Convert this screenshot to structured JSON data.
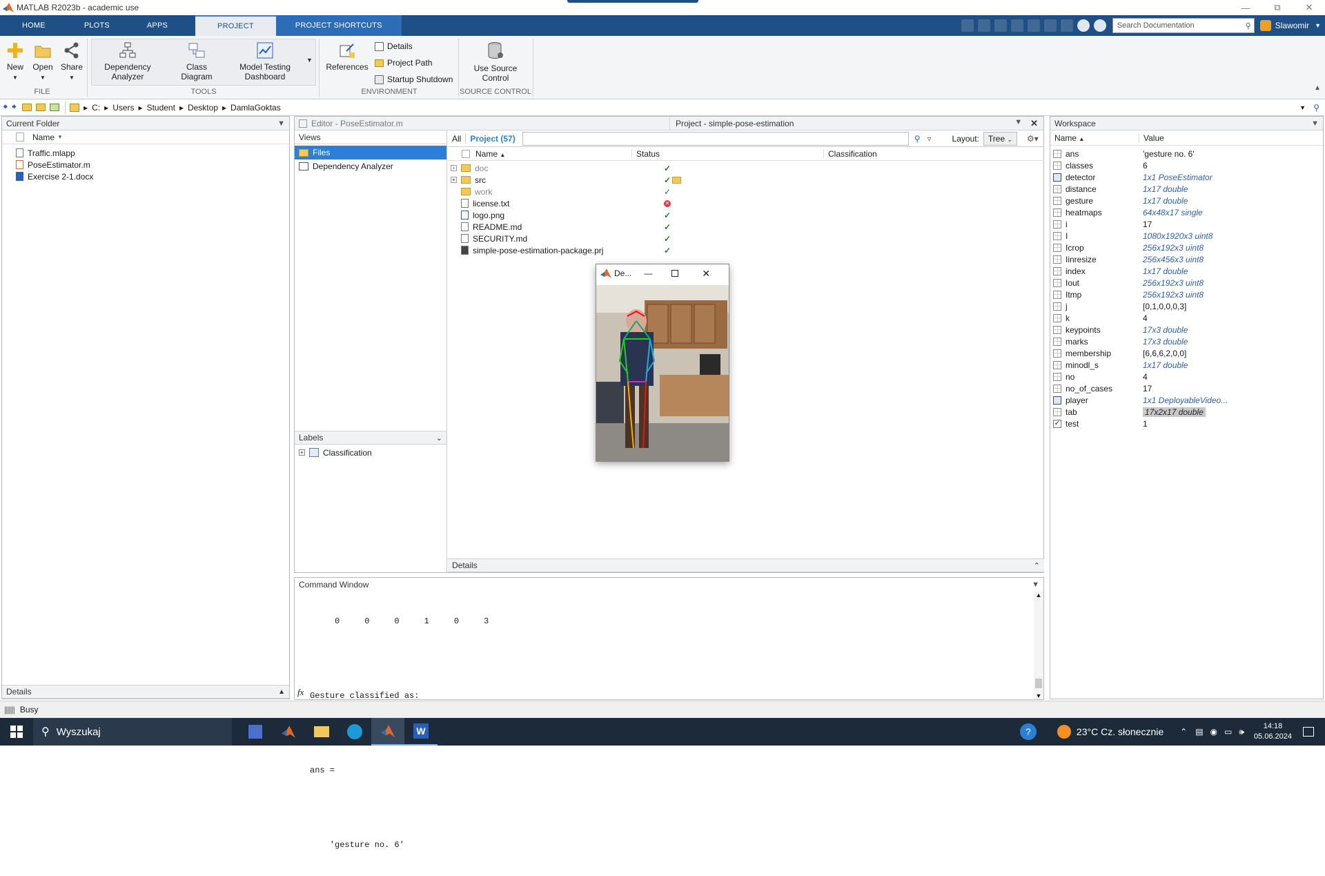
{
  "window": {
    "title": "MATLAB R2023b - academic use"
  },
  "tabs": {
    "home": "HOME",
    "plots": "PLOTS",
    "apps": "APPS",
    "project": "PROJECT",
    "shortcuts": "PROJECT SHORTCUTS"
  },
  "search": {
    "placeholder": "Search Documentation"
  },
  "user": "Slawomir",
  "ribbon": {
    "file": {
      "new": "New",
      "open": "Open",
      "share": "Share",
      "label": "FILE"
    },
    "tools": {
      "dep1": "Dependency",
      "dep2": "Analyzer",
      "cls1": "Class",
      "cls2": "Diagram",
      "mt1": "Model Testing",
      "mt2": "Dashboard",
      "label": "TOOLS"
    },
    "env": {
      "references": "References",
      "details": "Details",
      "path": "Project Path",
      "startup": "Startup Shutdown",
      "label": "ENVIRONMENT"
    },
    "sc": {
      "use1": "Use Source",
      "use2": "Control",
      "label": "SOURCE CONTROL"
    }
  },
  "address": {
    "drive": "C:",
    "p1": "Users",
    "p2": "Student",
    "p3": "Desktop",
    "p4": "DamlaGoktas"
  },
  "current_folder": {
    "title": "Current Folder",
    "col_name": "Name",
    "files": [
      "Traffic.mlapp",
      "PoseEstimator.m",
      "Exercise 2-1.docx"
    ],
    "details": "Details",
    "status": "Busy"
  },
  "editor_tab": "Editor - PoseEstimator.m",
  "project_tab": "Project - simple-pose-estimation",
  "views": {
    "title": "Views",
    "files": "Files",
    "dep": "Dependency Analyzer"
  },
  "labels": {
    "title": "Labels",
    "classification": "Classification"
  },
  "project": {
    "all": "All",
    "count": "Project (57)",
    "layout_label": "Layout:",
    "layout_value": "Tree",
    "col_name": "Name",
    "col_status": "Status",
    "col_class": "Classification",
    "rows": [
      "doc",
      "src",
      "work",
      "license.txt",
      "logo.png",
      "README.md",
      "SECURITY.md",
      "simple-pose-estimation-package.prj"
    ],
    "details": "Details"
  },
  "figure": {
    "title": "De..."
  },
  "command": {
    "title": "Command Window",
    "line1": "     0     0     0     1     0     3",
    "line2": "Gesture classified as:",
    "line3": "ans =",
    "line4": "    'gesture no. 6'",
    "prompt": "fx"
  },
  "workspace": {
    "title": "Workspace",
    "col_name": "Name",
    "col_value": "Value",
    "vars": [
      {
        "name": "ans",
        "value": "'gesture no. 6'"
      },
      {
        "name": "classes",
        "value": "6"
      },
      {
        "name": "detector",
        "value": "1x1 PoseEstimator"
      },
      {
        "name": "distance",
        "value": "1x17 double"
      },
      {
        "name": "gesture",
        "value": "1x17 double"
      },
      {
        "name": "heatmaps",
        "value": "64x48x17 single"
      },
      {
        "name": "i",
        "value": "17"
      },
      {
        "name": "I",
        "value": "1080x1920x3 uint8"
      },
      {
        "name": "Icrop",
        "value": "256x192x3 uint8"
      },
      {
        "name": "Iinresize",
        "value": "256x456x3 uint8"
      },
      {
        "name": "index",
        "value": "1x17 double"
      },
      {
        "name": "Iout",
        "value": "256x192x3 uint8"
      },
      {
        "name": "Itmp",
        "value": "256x192x3 uint8"
      },
      {
        "name": "j",
        "value": "[0,1,0,0,0,3]"
      },
      {
        "name": "k",
        "value": "4"
      },
      {
        "name": "keypoints",
        "value": "17x3 double"
      },
      {
        "name": "marks",
        "value": "17x3 double"
      },
      {
        "name": "membership",
        "value": "[6,6,6,2,0,0]"
      },
      {
        "name": "minodl_s",
        "value": "1x17 double"
      },
      {
        "name": "no",
        "value": "4"
      },
      {
        "name": "no_of_cases",
        "value": "17"
      },
      {
        "name": "player",
        "value": "1x1 DeployableVideo..."
      },
      {
        "name": "tab",
        "value": "17x2x17 double"
      },
      {
        "name": "test",
        "value": "1"
      }
    ]
  },
  "taskbar": {
    "search": "Wyszukaj",
    "weather": "23°C  Cz. słonecznie",
    "time": "14:18",
    "date": "05.06.2024"
  }
}
